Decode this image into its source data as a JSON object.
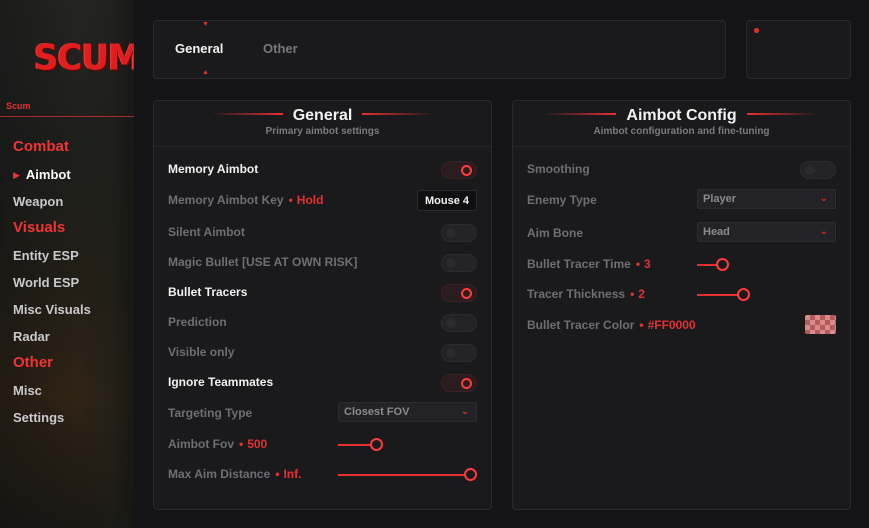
{
  "app": {
    "logo": "SCUM",
    "caption": "Scum"
  },
  "nav": {
    "combat": {
      "title": "Combat",
      "items": [
        "Aimbot",
        "Weapon"
      ]
    },
    "visuals": {
      "title": "Visuals",
      "items": [
        "Entity ESP",
        "World ESP",
        "Misc Visuals",
        "Radar"
      ]
    },
    "other": {
      "title": "Other",
      "items": [
        "Misc",
        "Settings"
      ]
    },
    "active": "Aimbot"
  },
  "tabs": {
    "general": "General",
    "other": "Other",
    "active": "General"
  },
  "general": {
    "title": "General",
    "subtitle": "Primary aimbot settings",
    "memory_aimbot": {
      "label": "Memory Aimbot",
      "on": true
    },
    "memory_aimbot_key": {
      "label": "Memory Aimbot Key",
      "mode": "Hold",
      "key": "Mouse 4"
    },
    "silent_aimbot": {
      "label": "Silent Aimbot",
      "on": false
    },
    "magic_bullet": {
      "label": "Magic Bullet [USE AT OWN RISK]",
      "on": false
    },
    "bullet_tracers": {
      "label": "Bullet Tracers",
      "on": true
    },
    "prediction": {
      "label": "Prediction",
      "on": false
    },
    "visible_only": {
      "label": "Visible only",
      "on": false
    },
    "ignore_teammates": {
      "label": "Ignore Teammates",
      "on": true
    },
    "targeting_type": {
      "label": "Targeting Type",
      "value": "Closest FOV"
    },
    "aimbot_fov": {
      "label": "Aimbot Fov",
      "value": "500",
      "fraction": 0.25
    },
    "max_aim_distance": {
      "label": "Max Aim Distance",
      "value": "Inf.",
      "fraction": 1.0
    }
  },
  "aimbot_config": {
    "title": "Aimbot Config",
    "subtitle": "Aimbot configuration and fine-tuning",
    "smoothing": {
      "label": "Smoothing",
      "on": false
    },
    "enemy_type": {
      "label": "Enemy Type",
      "value": "Player"
    },
    "aim_bone": {
      "label": "Aim Bone",
      "value": "Head"
    },
    "bullet_tracer_time": {
      "label": "Bullet Tracer Time",
      "value": "3",
      "fraction": 0.15
    },
    "tracer_thickness": {
      "label": "Tracer Thickness",
      "value": "2",
      "fraction": 0.32
    },
    "bullet_tracer_color": {
      "label": "Bullet Tracer Color",
      "value": "#FF0000"
    }
  },
  "colors": {
    "accent": "#e53030",
    "panel": "#1a1a1d",
    "background": "#141416"
  }
}
